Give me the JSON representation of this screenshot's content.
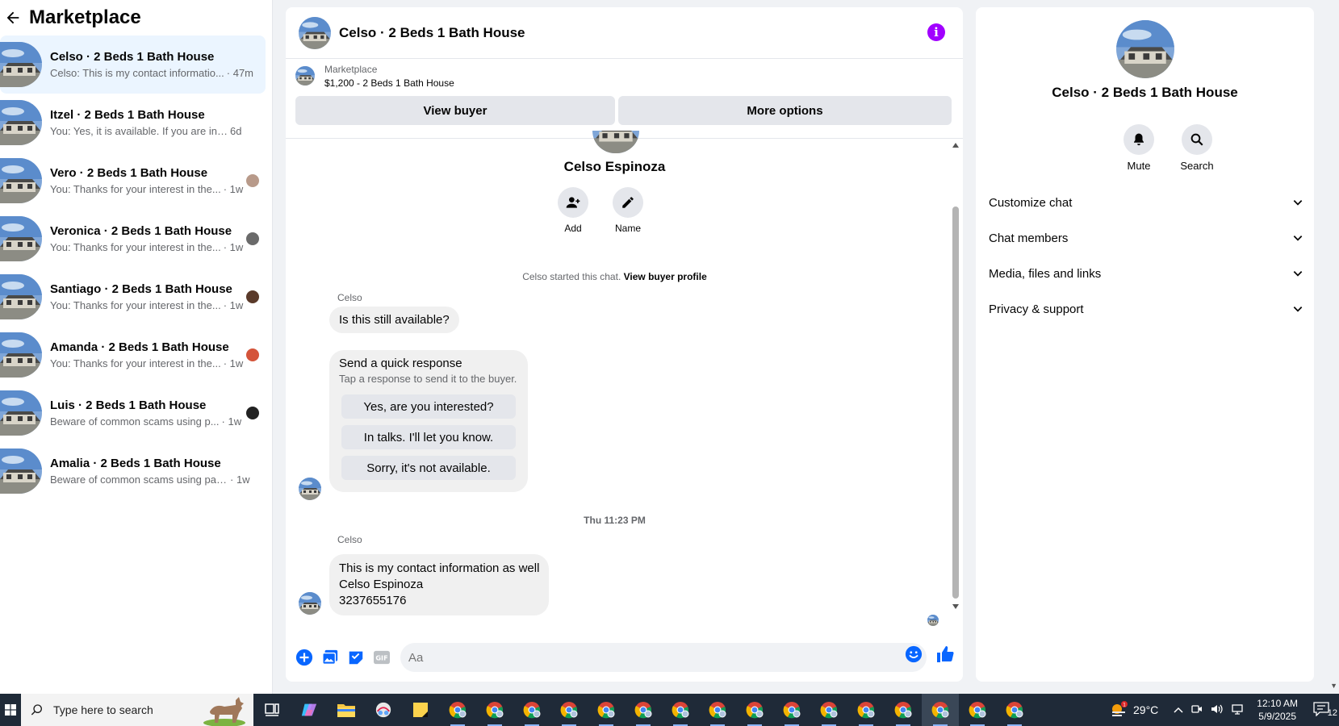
{
  "sidebar": {
    "title": "Marketplace",
    "conversations": [
      {
        "name": "Celso · 2 Beds 1 Bath House",
        "preview": "Celso: This is my contact informatio...",
        "time": "· 47m",
        "mini": ""
      },
      {
        "name": "Itzel · 2 Beds 1 Bath House",
        "preview": "You: Yes, it is available. If you are inter...",
        "time": "6d",
        "mini": ""
      },
      {
        "name": "Vero · 2 Beds 1 Bath House",
        "preview": "You: Thanks for your interest in the...",
        "time": "· 1w",
        "mini": "#b89a8a"
      },
      {
        "name": "Veronica · 2 Beds 1 Bath House",
        "preview": "You: Thanks for your interest in the...",
        "time": "· 1w",
        "mini": "#6a6a6a"
      },
      {
        "name": "Santiago · 2 Beds 1 Bath House",
        "preview": "You: Thanks for your interest in the...",
        "time": "· 1w",
        "mini": "#5a3a2a"
      },
      {
        "name": "Amanda · 2 Beds 1 Bath House",
        "preview": "You: Thanks for your interest in the...",
        "time": "· 1w",
        "mini": "#d4543a"
      },
      {
        "name": "Luis · 2 Beds 1 Bath House",
        "preview": "Beware of common scams using p...",
        "time": "· 1w",
        "mini": "#222222"
      },
      {
        "name": "Amalia · 2 Beds 1 Bath House",
        "preview": "Beware of common scams using pay...",
        "time": "· 1w",
        "mini": ""
      }
    ]
  },
  "chat": {
    "title": "Celso · 2 Beds 1 Bath House",
    "info_icon": "info-icon",
    "listing_source": "Marketplace",
    "listing_title": "$1,200 - 2 Beds 1 Bath House",
    "view_buyer": "View buyer",
    "more_options": "More options",
    "profile_name": "Celso Espinoza",
    "add_label": "Add",
    "name_label": "Name",
    "started_text": "Celso started this chat.",
    "view_profile": "View buyer profile",
    "sender1": "Celso",
    "msg1": "Is this still available?",
    "quick_title": "Send a quick response",
    "quick_sub": "Tap a response to send it to the buyer.",
    "quick_options": [
      "Yes, are you interested?",
      "In talks. I'll let you know.",
      "Sorry, it's not available."
    ],
    "timestamp": "Thu 11:23 PM",
    "sender2": "Celso",
    "contact_lines": [
      "This is my contact information as well",
      "Celso Espinoza",
      "3237655176"
    ],
    "composer_placeholder": "Aa"
  },
  "details": {
    "name": "Celso · 2 Beds 1 Bath House",
    "mute": "Mute",
    "search": "Search",
    "sections": [
      "Customize chat",
      "Chat members",
      "Media, files and links",
      "Privacy & support"
    ]
  },
  "taskbar": {
    "search_placeholder": "Type here to search",
    "temperature": "29°C",
    "time": "12:10 AM",
    "date": "5/9/2025",
    "notifications": "12"
  },
  "colors": {
    "accent": "#0866ff",
    "info": "#a100ff",
    "taskbar": "#1f2a38"
  }
}
